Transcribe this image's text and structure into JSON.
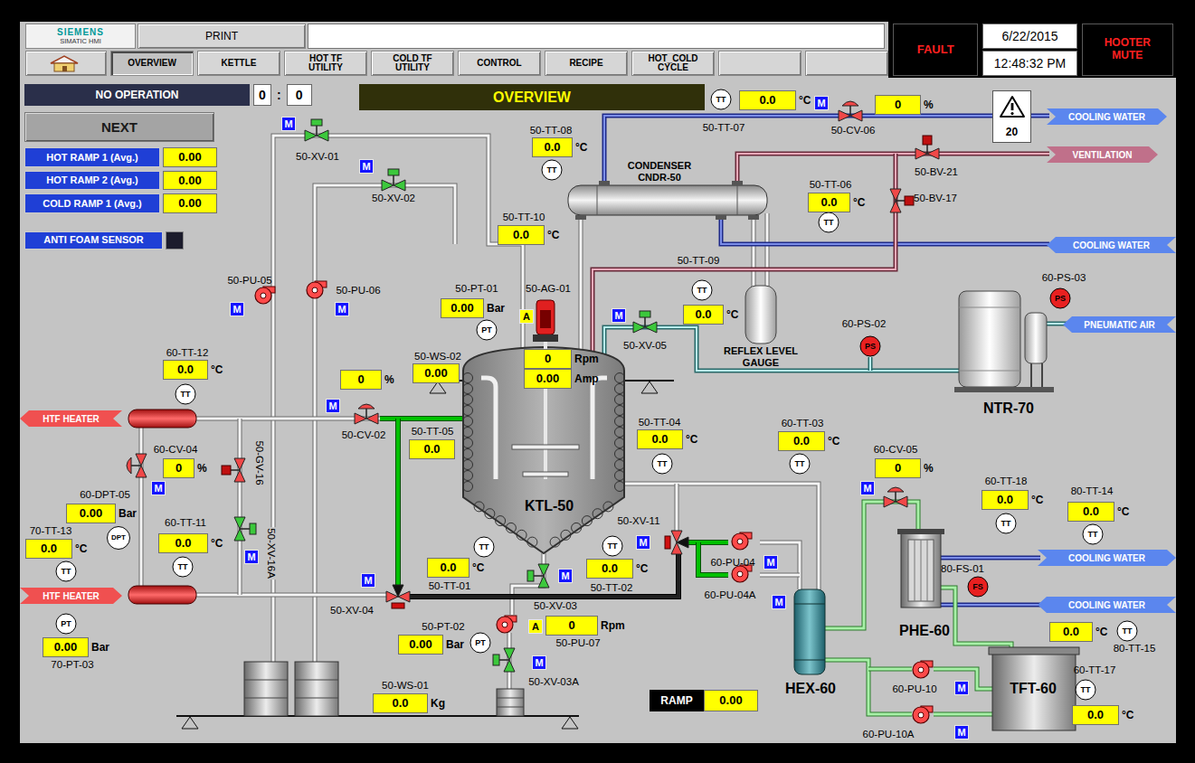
{
  "header": {
    "logo": {
      "brand": "SIEMENS",
      "product": "SIMATIC HMI"
    },
    "print": "PRINT",
    "fault": "FAULT",
    "date": "6/22/2015",
    "time": "12:48:32 PM",
    "hooter": "HOOTER MUTE",
    "tabs": [
      {
        "label": "",
        "kind": "home",
        "selected": false
      },
      {
        "label": "OVERVIEW",
        "kind": "text",
        "selected": true
      },
      {
        "label": "KETTLE",
        "kind": "text",
        "selected": false
      },
      {
        "label": "HOT TF UTILITY",
        "kind": "text",
        "selected": false
      },
      {
        "label": "COLD TF UTILITY",
        "kind": "text",
        "selected": false
      },
      {
        "label": "CONTROL",
        "kind": "text",
        "selected": false
      },
      {
        "label": "RECIPE",
        "kind": "text",
        "selected": false
      },
      {
        "label": "HOT_COLD CYCLE",
        "kind": "text",
        "selected": false
      },
      {
        "label": "",
        "kind": "text",
        "selected": false
      },
      {
        "label": "",
        "kind": "text",
        "selected": false
      }
    ]
  },
  "panel": {
    "status": "NO OPERATION",
    "counter": {
      "hours": "0",
      "separator": ":",
      "minutes": "0"
    },
    "next": "NEXT",
    "ramps": [
      {
        "label": "HOT RAMP 1 (Avg.)",
        "value": "0.00"
      },
      {
        "label": "HOT RAMP 2 (Avg.)",
        "value": "0.00"
      },
      {
        "label": "COLD RAMP 1 (Avg.)",
        "value": "0.00"
      }
    ],
    "anti_foam": {
      "label": "ANTI FOAM SENSOR",
      "on": false
    }
  },
  "banner": "OVERVIEW",
  "alarm": {
    "count": "20"
  },
  "ramp": {
    "label": "RAMP",
    "value": "0.00"
  },
  "diagram": {
    "readouts": [
      {
        "value": "0.0",
        "unit": "°C"
      },
      {
        "value": "0",
        "unit": "%"
      },
      {
        "value": "0.0",
        "unit": "°C"
      },
      {
        "value": "0.0",
        "unit": "°C"
      },
      {
        "value": "0.0",
        "unit": "°C"
      },
      {
        "value": "0.00",
        "unit": "Bar"
      },
      {
        "value": "0.0",
        "unit": "°C"
      },
      {
        "value": "0",
        "unit": "Rpm"
      },
      {
        "value": "0.00",
        "unit": "Amp"
      },
      {
        "value": "0.00",
        "unit": ""
      },
      {
        "value": "0",
        "unit": "%"
      },
      {
        "value": "0.0",
        "unit": "°C"
      },
      {
        "value": "0.0",
        "unit": ""
      },
      {
        "value": "0",
        "unit": "%"
      },
      {
        "value": "0.0",
        "unit": "°C"
      },
      {
        "value": "0.0",
        "unit": "°C"
      },
      {
        "value": "0",
        "unit": "%"
      },
      {
        "value": "0.00",
        "unit": "Bar"
      },
      {
        "value": "0.0",
        "unit": "°C"
      },
      {
        "value": "0.0",
        "unit": "°C"
      },
      {
        "value": "0.0",
        "unit": "°C"
      },
      {
        "value": "0.0",
        "unit": "°C"
      },
      {
        "value": "0.0",
        "unit": "°C"
      },
      {
        "value": "0.0",
        "unit": "°C"
      },
      {
        "value": "0",
        "unit": "Rpm"
      },
      {
        "value": "0.0",
        "unit": "°C"
      },
      {
        "value": "0.00",
        "unit": "Bar"
      },
      {
        "value": "0.00",
        "unit": "Bar"
      },
      {
        "value": "0.0",
        "unit": "Kg"
      },
      {
        "value": "0.0",
        "unit": "°C"
      }
    ],
    "tags": [
      "50-TT-07",
      "50-CV-06",
      "50-TT-08",
      "50-XV-01",
      "50-BV-21",
      "50-TT-06",
      "50-XV-02",
      "50-BV-17",
      "50-TT-10",
      "50-TT-09",
      "60-PS-03",
      "50-PU-05",
      "50-PT-01",
      "50-AG-01",
      "50-PU-06",
      "60-PS-02",
      "50-XV-05",
      "60-TT-12",
      "50-WS-02",
      "60-TT-03",
      "50-TT-04",
      "50-TT-05",
      "50-CV-02",
      "60-CV-04",
      "60-CV-05",
      "60-TT-18",
      "80-TT-14",
      "60-DPT-05",
      "50-XV-11",
      "60-TT-11",
      "70-TT-13",
      "60-PU-04",
      "80-FS-01",
      "50-TT-01",
      "50-TT-02",
      "60-PU-04A",
      "50-XV-03",
      "50-XV-04",
      "50-PT-02",
      "50-PU-07",
      "80-TT-15",
      "70-PT-03",
      "60-TT-17",
      "50-XV-03A",
      "50-WS-01",
      "60-PU-10",
      "60-PU-10A"
    ],
    "vertical_tags": [
      "50-GV-16",
      "50-XV-16A"
    ],
    "equipment": [
      {
        "name": "CONDENSER",
        "kind": "minor"
      },
      {
        "name": "CNDR-50",
        "kind": "minor"
      },
      {
        "name": "REFLEX LEVEL",
        "kind": "minor"
      },
      {
        "name": "GAUGE",
        "kind": "minor"
      },
      {
        "name": "KTL-50",
        "kind": "major"
      },
      {
        "name": "NTR-70",
        "kind": "major"
      },
      {
        "name": "HEX-60",
        "kind": "major"
      },
      {
        "name": "PHE-60",
        "kind": "major"
      },
      {
        "name": "TFT-60",
        "kind": "major"
      }
    ],
    "instruments": [
      {
        "type": "TT",
        "color": "#ffffff"
      },
      {
        "type": "TT",
        "color": "#ffffff"
      },
      {
        "type": "TT",
        "color": "#ffffff"
      },
      {
        "type": "TT",
        "color": "#ffffff"
      },
      {
        "type": "PT",
        "color": "#ffffff"
      },
      {
        "type": "PS",
        "color": "#e82020"
      },
      {
        "type": "PS",
        "color": "#e82020"
      },
      {
        "type": "TT",
        "color": "#ffffff"
      },
      {
        "type": "TT",
        "color": "#ffffff"
      },
      {
        "type": "TT",
        "color": "#ffffff"
      },
      {
        "type": "TT",
        "color": "#ffffff"
      },
      {
        "type": "TT",
        "color": "#ffffff"
      },
      {
        "type": "DPT",
        "color": "#ffffff"
      },
      {
        "type": "TT",
        "color": "#ffffff"
      },
      {
        "type": "TT",
        "color": "#ffffff"
      },
      {
        "type": "FS",
        "color": "#e82020"
      },
      {
        "type": "TT",
        "color": "#ffffff"
      },
      {
        "type": "TT",
        "color": "#ffffff"
      },
      {
        "type": "PT",
        "color": "#ffffff"
      },
      {
        "type": "TT",
        "color": "#ffffff"
      },
      {
        "type": "PT",
        "color": "#ffffff"
      },
      {
        "type": "TT",
        "color": "#ffffff"
      }
    ],
    "badges": [
      {
        "text": "M",
        "color": "#1414ff"
      },
      {
        "text": "M",
        "color": "#1414ff"
      },
      {
        "text": "M",
        "color": "#1414ff"
      },
      {
        "text": "M",
        "color": "#1414ff"
      },
      {
        "text": "M",
        "color": "#1414ff"
      },
      {
        "text": "A",
        "color": "#ffff00"
      },
      {
        "text": "M",
        "color": "#1414ff"
      },
      {
        "text": "M",
        "color": "#1414ff"
      },
      {
        "text": "M",
        "color": "#1414ff"
      },
      {
        "text": "M",
        "color": "#1414ff"
      },
      {
        "text": "M",
        "color": "#1414ff"
      },
      {
        "text": "M",
        "color": "#1414ff"
      },
      {
        "text": "M",
        "color": "#1414ff"
      },
      {
        "text": "M",
        "color": "#1414ff"
      },
      {
        "text": "M",
        "color": "#1414ff"
      },
      {
        "text": "M",
        "color": "#1414ff"
      },
      {
        "text": "A",
        "color": "#ffff00"
      },
      {
        "text": "M",
        "color": "#1414ff"
      },
      {
        "text": "M",
        "color": "#1414ff"
      },
      {
        "text": "M",
        "color": "#1414ff"
      }
    ],
    "valves": [
      {
        "kind": "onoff",
        "color": "#3cc83c"
      },
      {
        "kind": "onoff",
        "color": "#3cc83c"
      },
      {
        "kind": "control",
        "color": "#f04848"
      },
      {
        "kind": "ball",
        "color": "#f04848"
      },
      {
        "kind": "ball",
        "color": "#f04848"
      },
      {
        "kind": "onoff",
        "color": "#3cc83c"
      },
      {
        "kind": "control",
        "color": "#f04848"
      },
      {
        "kind": "control",
        "color": "#f04848"
      },
      {
        "kind": "ball",
        "color": "#f04848"
      },
      {
        "kind": "onoff",
        "color": "#3cc83c"
      },
      {
        "kind": "control",
        "color": "#f04848"
      },
      {
        "kind": "threeway",
        "color": "#f04848"
      },
      {
        "kind": "threeway",
        "color": "#f04848"
      },
      {
        "kind": "onoff",
        "color": "#3cc83c"
      },
      {
        "kind": "onoff",
        "color": "#3cc83c"
      }
    ],
    "pumps": [
      {
        "running": false
      },
      {
        "running": false
      },
      {
        "running": false
      },
      {
        "running": false
      },
      {
        "running": false
      },
      {
        "running": false
      },
      {
        "running": false
      }
    ],
    "utilities": [
      {
        "label": "COOLING WATER",
        "color": "#5b86ee"
      },
      {
        "label": "VENTILATION",
        "color": "#c0708a"
      },
      {
        "label": "COOLING WATER",
        "color": "#5b86ee"
      },
      {
        "label": "PNEUMATIC AIR",
        "color": "#5b86ee"
      },
      {
        "label": "COOLING WATER",
        "color": "#5b86ee"
      },
      {
        "label": "COOLING WATER",
        "color": "#5b86ee"
      },
      {
        "label": "HTF HEATER",
        "color": "#f05050"
      },
      {
        "label": "HTF HEATER",
        "color": "#f05050"
      }
    ]
  }
}
